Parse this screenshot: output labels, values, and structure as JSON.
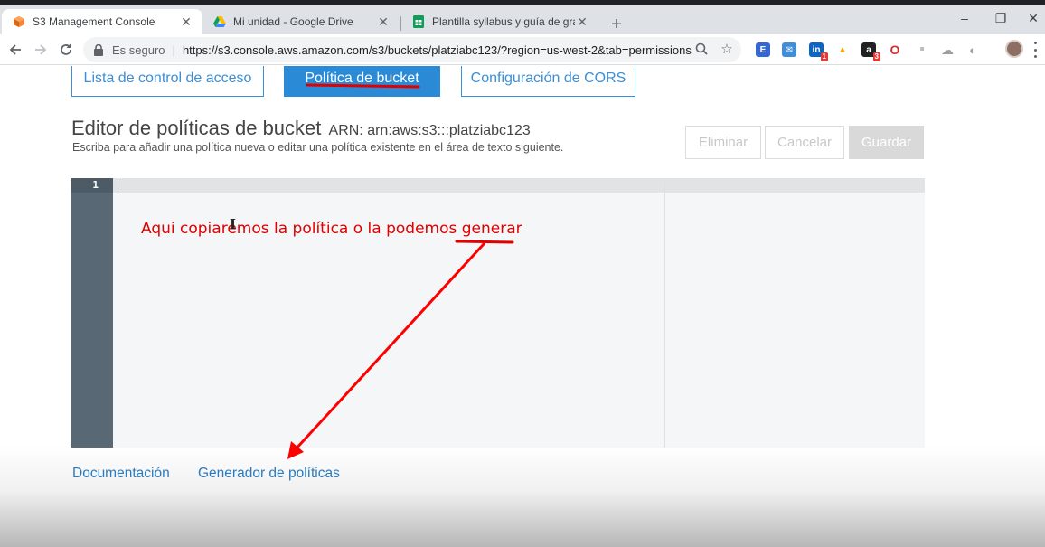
{
  "browser": {
    "tabs": [
      {
        "title": "S3 Management Console",
        "icon": "aws-cube-icon",
        "active": true
      },
      {
        "title": "Mi unidad - Google Drive",
        "icon": "google-drive-icon",
        "active": false
      },
      {
        "title": "Plantilla syllabus y guía de graba",
        "icon": "google-sheets-icon",
        "active": false
      }
    ],
    "new_tab_label": "+",
    "controls": {
      "minimize": "–",
      "restore": "❐",
      "close": "✕"
    },
    "omnibox": {
      "secure_label": "Es seguro",
      "url": "https://s3.console.aws.amazon.com/s3/buckets/platziabc123/?region=us-west-2&tab=permissions"
    },
    "extensions": [
      {
        "name": "e-ext-icon",
        "glyph": "E",
        "color": "#3367d6"
      },
      {
        "name": "inbox-ext-icon",
        "glyph": "✉",
        "color": "#3f8ed8"
      },
      {
        "name": "linkedin-ext-icon",
        "glyph": "in",
        "color": "#0a66c2",
        "badge": "1"
      },
      {
        "name": "triangle-ext-icon",
        "glyph": "▲",
        "color": "#f4a300"
      },
      {
        "name": "amazon-ext-icon",
        "glyph": "a",
        "color": "#222222",
        "badge": "3"
      },
      {
        "name": "opera-ext-icon",
        "glyph": "O",
        "color": "#d32f2f"
      },
      {
        "name": "grey-square-ext-icon",
        "glyph": "▪",
        "color": "#bdbdbd"
      },
      {
        "name": "cloud-ext-icon",
        "glyph": "☁",
        "color": "#9e9e9e"
      },
      {
        "name": "circle-ext-icon",
        "glyph": "◐",
        "color": "#9e9e9e"
      }
    ]
  },
  "page": {
    "tabs": [
      {
        "label": "Lista de control de acceso",
        "active": false
      },
      {
        "label": "Política de bucket",
        "active": true
      },
      {
        "label": "Configuración de CORS",
        "active": false
      }
    ],
    "editor": {
      "title": "Editor de políticas de bucket",
      "arn": "ARN: arn:aws:s3:::platziabc123",
      "subtitle": "Escriba para añadir una política nueva o editar una política existente en el área de texto siguiente.",
      "line_number": "1"
    },
    "actions": {
      "delete_label": "Eliminar",
      "cancel_label": "Cancelar",
      "save_label": "Guardar"
    },
    "annotation": "Aqui copiaremos la política o la podemos generar",
    "footer": {
      "docs_label": "Documentación",
      "generator_label": "Generador de políticas"
    },
    "colors": {
      "accent": "#2a8ad6",
      "annotation_red": "#e00000",
      "gutter": "#586874"
    }
  }
}
